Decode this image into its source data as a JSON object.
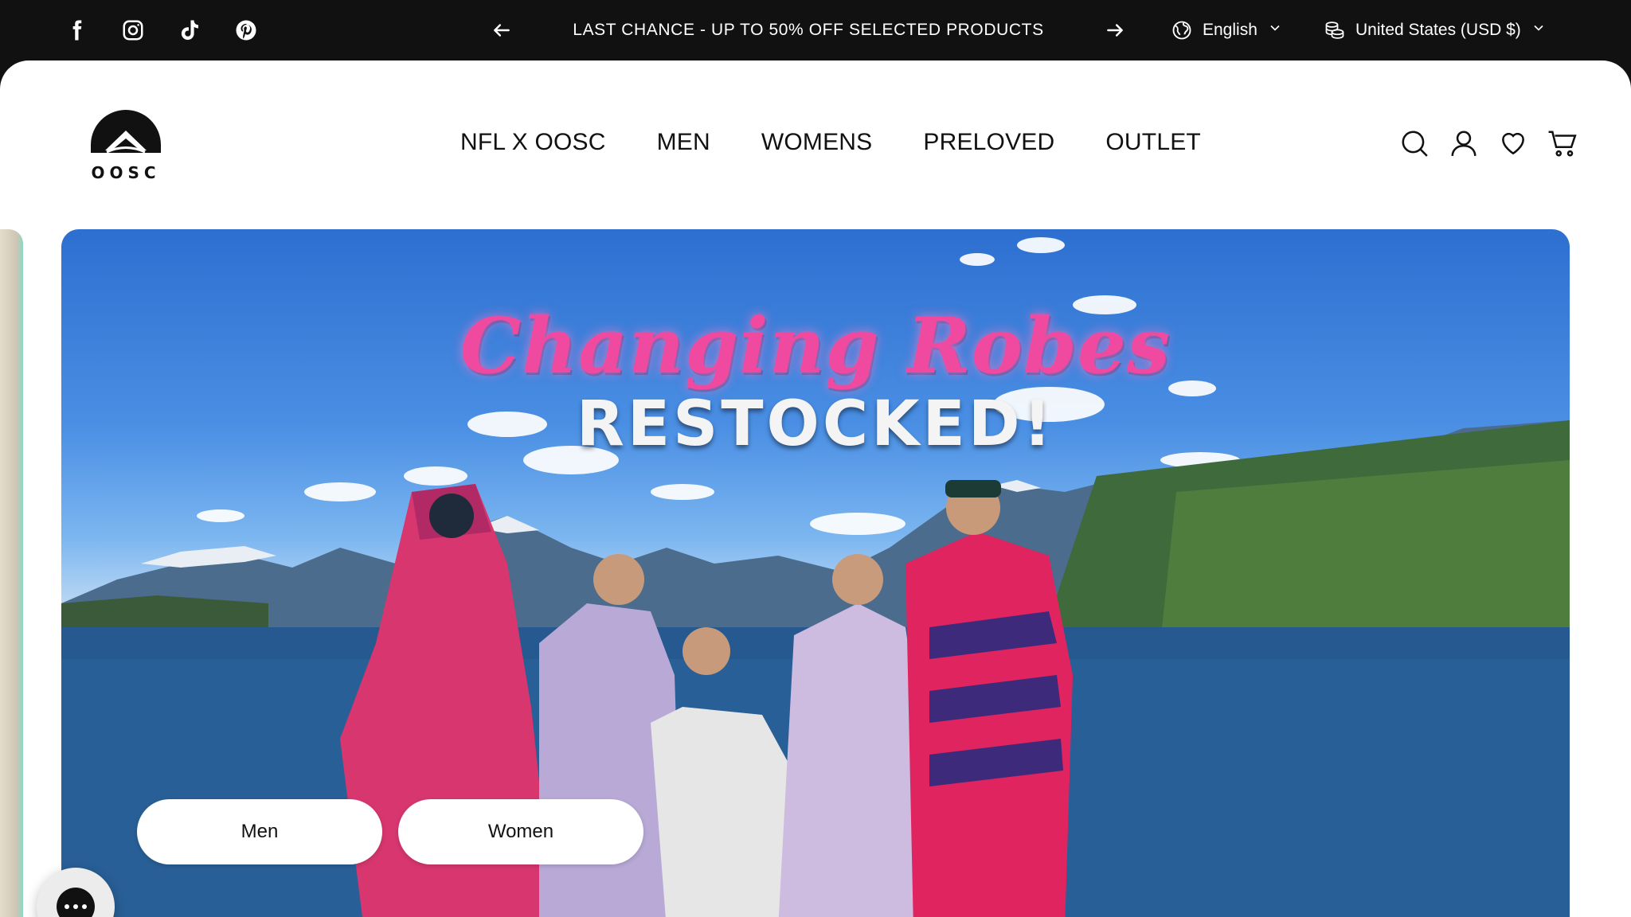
{
  "topbar": {
    "social": [
      {
        "name": "facebook-icon"
      },
      {
        "name": "instagram-icon"
      },
      {
        "name": "tiktok-icon"
      },
      {
        "name": "pinterest-icon"
      }
    ],
    "announcement": "LAST CHANCE - UP TO 50% OFF SELECTED PRODUCTS",
    "language": "English",
    "currency": "United States (USD $)"
  },
  "header": {
    "logo_text": "OOSC",
    "nav": [
      "NFL X OOSC",
      "MEN",
      "WOMENS",
      "PRELOVED",
      "OUTLET"
    ]
  },
  "hero": {
    "headline_script": "Changing Robes",
    "headline_bold": "RESTOCKED!",
    "buttons": {
      "men": "Men",
      "women": "Women"
    }
  },
  "colors": {
    "topbar_bg": "#111111",
    "headline_pink": "#ef4aa0",
    "page_bg": "#ffffff"
  }
}
